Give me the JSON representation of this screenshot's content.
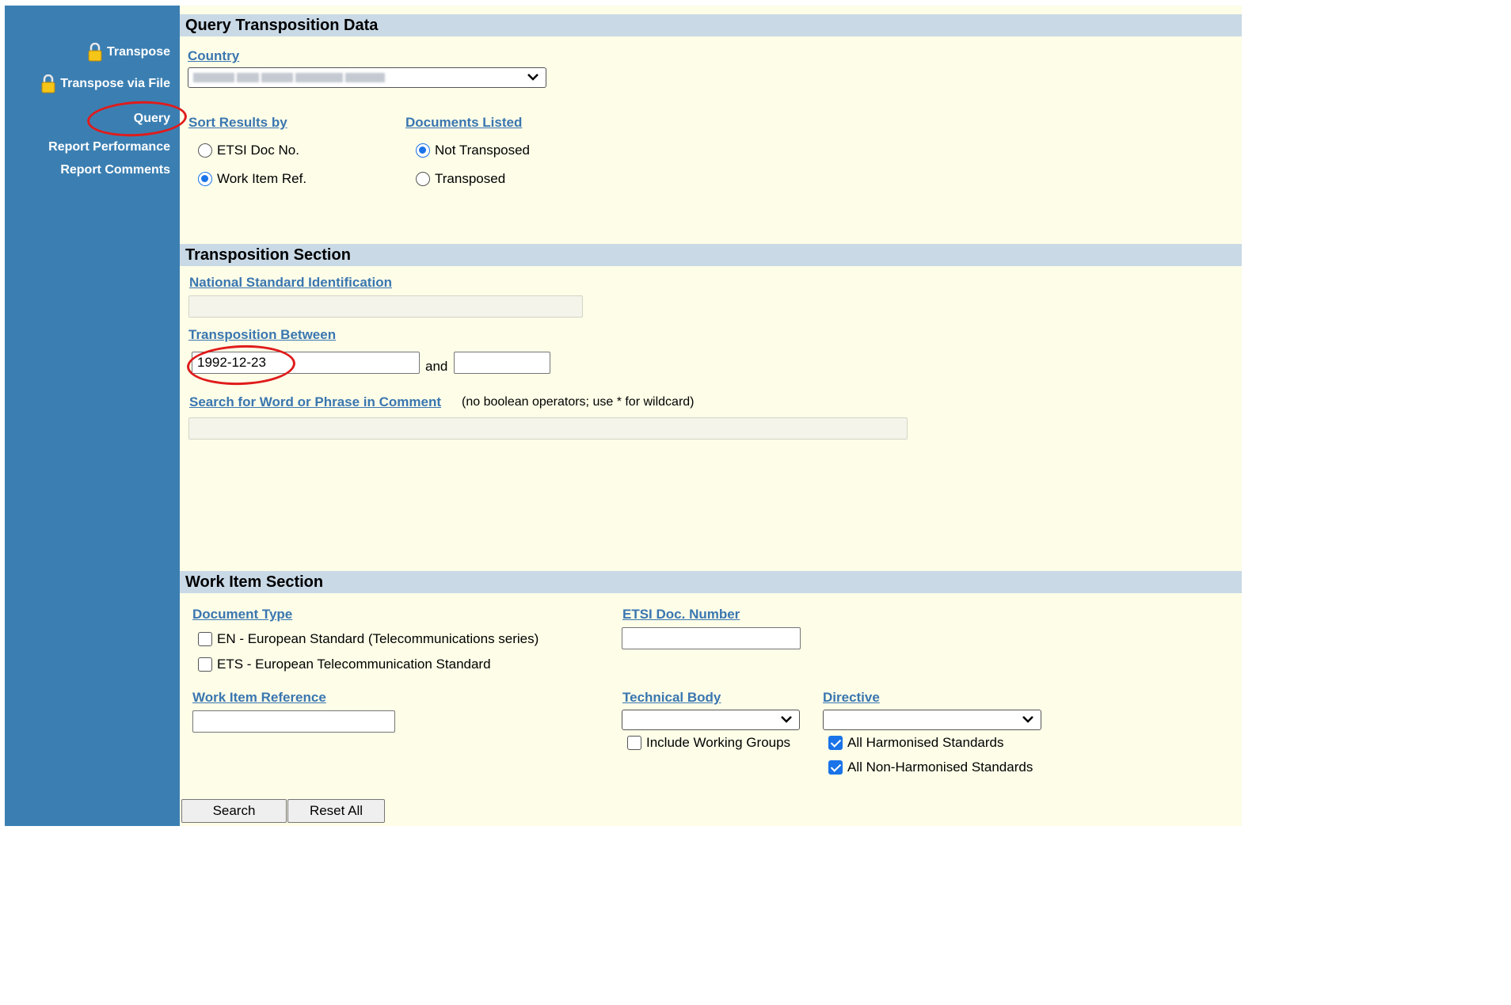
{
  "sidebar": {
    "items": [
      {
        "label": "Transpose",
        "locked": true
      },
      {
        "label": "Transpose via File",
        "locked": true
      },
      {
        "label": "Query",
        "locked": false
      },
      {
        "label": "Report Performance",
        "locked": false
      },
      {
        "label": "Report Comments",
        "locked": false
      }
    ],
    "background": "#3b7fb2"
  },
  "query_section": {
    "title": "Query Transposition Data",
    "country_label": "Country",
    "country_value": "",
    "sort_label": "Sort Results by",
    "sort_options": [
      {
        "label": "ETSI Doc No.",
        "selected": false
      },
      {
        "label": "Work Item Ref.",
        "selected": true
      }
    ],
    "docs_label": "Documents Listed",
    "docs_options": [
      {
        "label": "Not Transposed",
        "selected": true
      },
      {
        "label": "Transposed",
        "selected": false
      }
    ]
  },
  "transposition_section": {
    "title": "Transposition Section",
    "nsi_label": "National Standard Identification",
    "nsi_value": "",
    "between_label": "Transposition Between",
    "from_value": "1992-12-23",
    "and_text": "and",
    "to_value": "",
    "search_label": "Search for Word or Phrase in Comment",
    "search_hint": "(no boolean operators; use * for wildcard)",
    "search_value": ""
  },
  "work_item_section": {
    "title": "Work Item Section",
    "doc_type_label": "Document Type",
    "doc_types": [
      {
        "label": "EN - European Standard (Telecommunications series)",
        "checked": false
      },
      {
        "label": "ETS - European Telecommunication Standard",
        "checked": false
      }
    ],
    "etsi_doc_number_label": "ETSI Doc. Number",
    "etsi_doc_number_value": "",
    "work_item_ref_label": "Work Item Reference",
    "work_item_ref_value": "",
    "technical_body_label": "Technical Body",
    "technical_body_value": "",
    "include_wg_label": "Include Working Groups",
    "include_wg_checked": false,
    "directive_label": "Directive",
    "directive_value": "",
    "harmonised_label": "All Harmonised Standards",
    "harmonised_checked": true,
    "non_harmonised_label": "All Non-Harmonised Standards",
    "non_harmonised_checked": true
  },
  "buttons": {
    "search": "Search",
    "reset": "Reset All"
  },
  "colors": {
    "accent": "#3a76b0",
    "section_header": "#c9d9e6",
    "main_background": "#fdfde8",
    "highlight_circle": "#e01b1b"
  },
  "icons": {
    "lock": "lock-icon",
    "dropdown": "chevron-down-icon"
  }
}
